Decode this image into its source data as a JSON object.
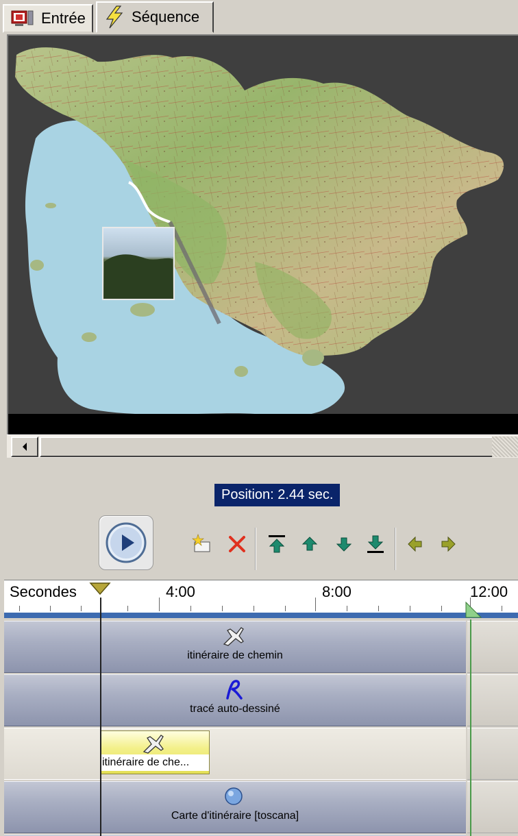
{
  "tabs": [
    {
      "label": "Entrée",
      "icon": "monitor-icon"
    },
    {
      "label": "Séquence",
      "icon": "lightning-icon"
    }
  ],
  "position_label": "Position: 2.44 sec.",
  "toolbar": {
    "play": "play-icon",
    "tools": [
      "add-clip-icon",
      "delete-icon",
      "move-top-icon",
      "move-up-icon",
      "move-down-icon",
      "move-bottom-icon",
      "arrow-left-icon",
      "arrow-right-icon"
    ]
  },
  "ruler": {
    "unit_label": "Secondes",
    "ticks": [
      "4:00",
      "8:00",
      "12:00"
    ]
  },
  "tracks": [
    {
      "label": "itinéraire de chemin",
      "icon": "plane-icon"
    },
    {
      "label": "tracé auto-dessiné",
      "icon": "path-drawing-icon"
    },
    {
      "label": "itinéraire de che...",
      "icon": "plane-icon"
    },
    {
      "label": "Carte d'itinéraire [toscana]",
      "icon": "globe-icon"
    }
  ],
  "colors": {
    "selection": "#0a246a",
    "track_blue": "#a8aec2",
    "clip_yellow": "#f3f08a",
    "sea": "#a9d3e3",
    "land": "#a9bf78"
  }
}
